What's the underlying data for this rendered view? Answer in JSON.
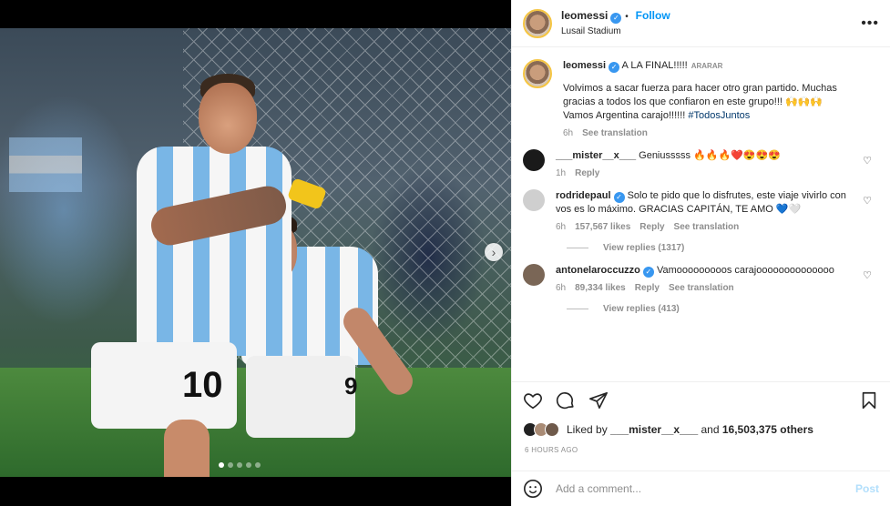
{
  "post": {
    "username": "leomessi",
    "follow_label": "Follow",
    "location": "Lusail Stadium",
    "more_icon": "more-horizontal-icon",
    "media": {
      "carousel_dots": 5,
      "active_dot": 0,
      "jersey_number_main": "10",
      "jersey_number_second": "9"
    }
  },
  "caption": {
    "username": "leomessi",
    "headline": "A LA FINAL!!!!!",
    "tag": "ARARAR",
    "line1": "Volvimos a sacar fuerza para hacer otro gran partido. Muchas gracias a todos los que confiaron en este grupo!!! 🙌🙌🙌",
    "line2": "Vamos Argentina carajo!!!!!!",
    "hashtag": "#TodosJuntos",
    "age": "6h",
    "see_translation": "See translation"
  },
  "comments": [
    {
      "username": "___mister__x___",
      "text": "Geniusssss 🔥🔥🔥❤️😍😍😍",
      "age": "1h",
      "reply": "Reply"
    },
    {
      "username": "rodridepaul",
      "text": "Solo te pido que lo disfrutes, este viaje vivirlo con vos es lo máximo. GRACIAS CAPITÁN, TE AMO 💙🤍",
      "age": "6h",
      "likes": "157,567 likes",
      "reply": "Reply",
      "see_translation": "See translation",
      "view_replies": "View replies (1317)"
    },
    {
      "username": "antonelaroccuzzo",
      "text": "Vamooooooooos carajoooooooooooooo",
      "age": "6h",
      "likes": "89,334 likes",
      "reply": "Reply",
      "see_translation": "See translation",
      "view_replies": "View replies (413)"
    }
  ],
  "likes": {
    "liked_by": "Liked by",
    "first_liker": "___mister__x___",
    "and": "and",
    "others": "16,503,375 others"
  },
  "timestamp": "6 HOURS AGO",
  "add_comment": {
    "placeholder": "Add a comment...",
    "post_label": "Post"
  }
}
